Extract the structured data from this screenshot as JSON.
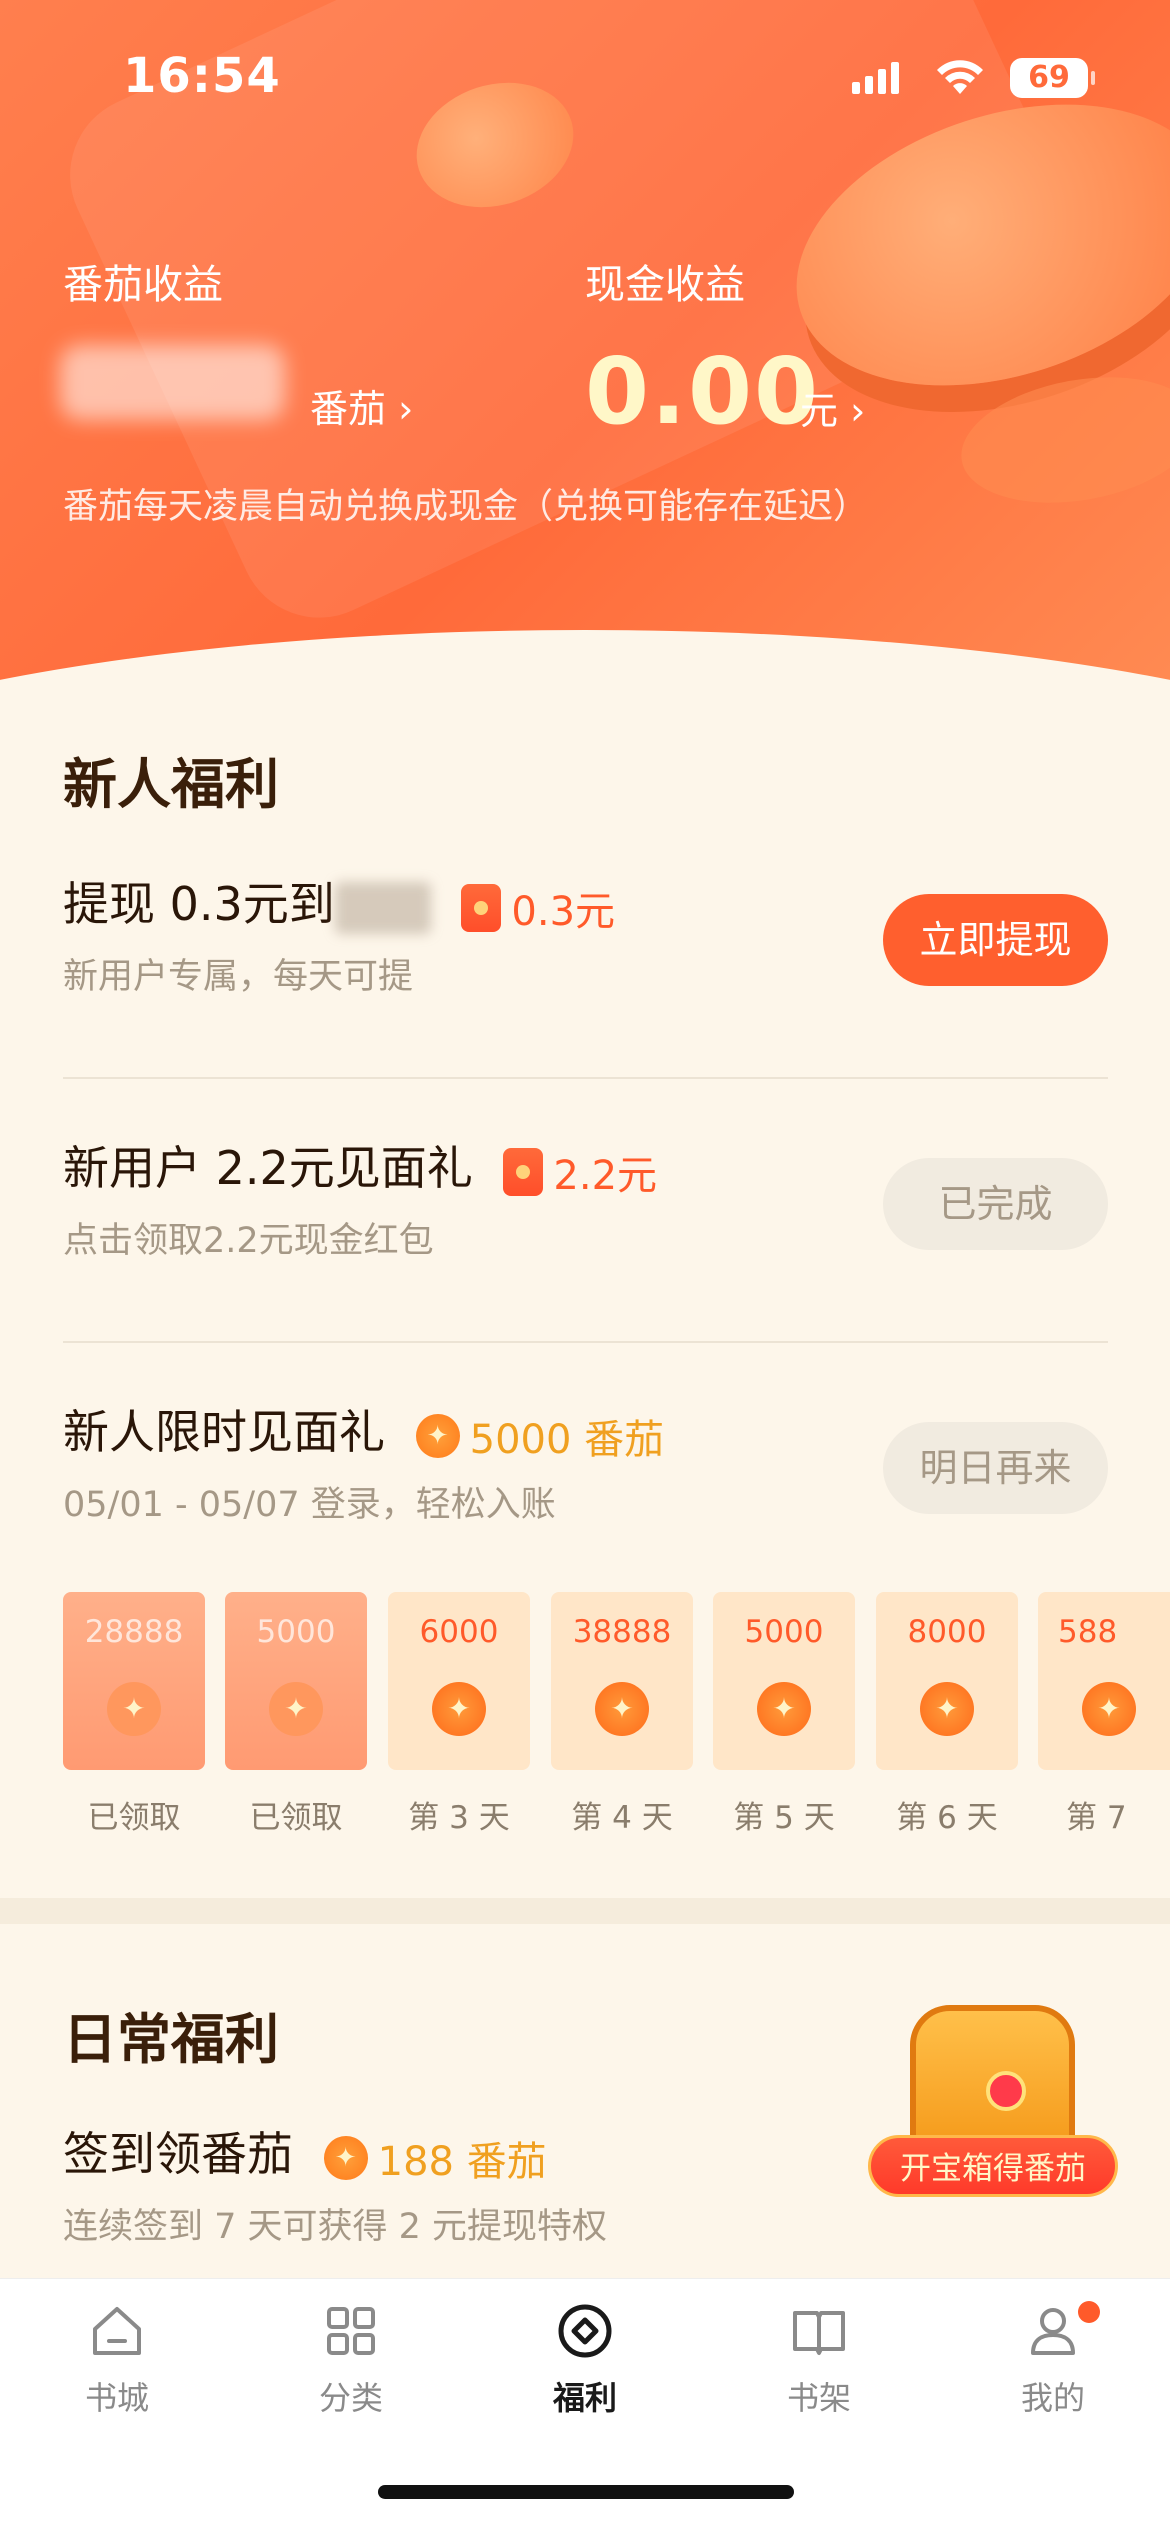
{
  "status_bar": {
    "time": "16:54",
    "battery": "69"
  },
  "earnings": {
    "tomato_label": "番茄收益",
    "tomato_unit": "番茄 ›",
    "cash_label": "现金收益",
    "cash_value": "0.00",
    "cash_unit": "元 ›",
    "note": "番茄每天凌晨自动兑换成现金（兑换可能存在延迟）"
  },
  "new_user": {
    "title": "新人福利",
    "tasks": [
      {
        "title_prefix": "提现 0.3元到",
        "reward": "0.3元",
        "subtitle": "新用户专属，每天可提",
        "button": "立即提现"
      },
      {
        "title_prefix": "新用户 2.2元见面礼",
        "reward": "2.2元",
        "subtitle": "点击领取2.2元现金红包",
        "button": "已完成"
      },
      {
        "title_prefix": "新人限时见面礼",
        "reward": "5000 番茄",
        "subtitle": "05/01 - 05/07 登录，轻松入账",
        "button": "明日再来"
      }
    ],
    "days": [
      {
        "amount": "28888",
        "label": "已领取",
        "claimed": true
      },
      {
        "amount": "5000",
        "label": "已领取",
        "claimed": true
      },
      {
        "amount": "6000",
        "label": "第 3 天",
        "claimed": false
      },
      {
        "amount": "38888",
        "label": "第 4 天",
        "claimed": false
      },
      {
        "amount": "5000",
        "label": "第 5 天",
        "claimed": false
      },
      {
        "amount": "8000",
        "label": "第 6 天",
        "claimed": false
      },
      {
        "amount": "588",
        "label": "第 7",
        "claimed": false
      }
    ]
  },
  "daily": {
    "title": "日常福利",
    "signin_title": "签到领番茄",
    "signin_reward": "188 番茄",
    "signin_sub": "连续签到 7 天可获得 2 元提现特权",
    "treasure_banner": "开宝箱得番茄"
  },
  "tabs": [
    {
      "label": "书城",
      "icon": "home-icon"
    },
    {
      "label": "分类",
      "icon": "grid-icon"
    },
    {
      "label": "福利",
      "icon": "welfare-coin-icon"
    },
    {
      "label": "书架",
      "icon": "book-icon"
    },
    {
      "label": "我的",
      "icon": "profile-icon"
    }
  ],
  "colors": {
    "accent": "#ff5f2e",
    "header": "#ff6a3a",
    "background": "#fdf6ea"
  }
}
